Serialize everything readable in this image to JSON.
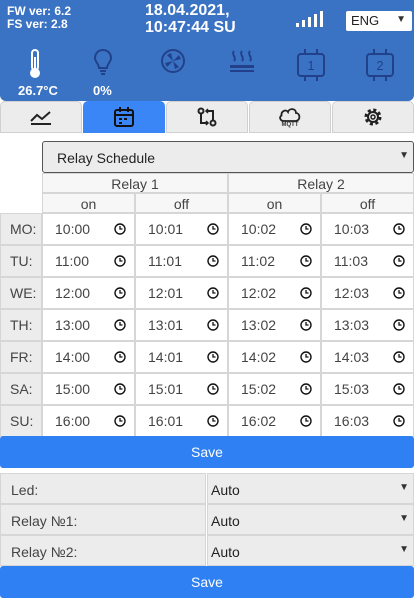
{
  "header": {
    "fw_version": "FW ver: 6.2",
    "fs_version": "FS ver: 2.8",
    "date": "18.04.2021,",
    "time": "10:47:44 SU",
    "language": "ENG",
    "temperature": "26.7°C",
    "light_level": "0%",
    "icons": [
      "thermometer-icon",
      "bulb-icon",
      "fan-icon",
      "heater-icon",
      "relay-1-icon",
      "relay-2-icon"
    ],
    "relay_1_label": "1",
    "relay_2_label": "2"
  },
  "tabs": [
    {
      "name": "chart",
      "active": false
    },
    {
      "name": "calendar",
      "active": true
    },
    {
      "name": "relays",
      "active": false
    },
    {
      "name": "mqtt",
      "label": "MQTT",
      "active": false
    },
    {
      "name": "settings",
      "active": false
    }
  ],
  "schedule": {
    "selected": "Relay Schedule",
    "relays": [
      "Relay 1",
      "Relay 2"
    ],
    "columns": [
      "on",
      "off",
      "on",
      "off"
    ],
    "rows": [
      {
        "day": "MO:",
        "times": [
          "10:00",
          "10:01",
          "10:02",
          "10:03"
        ]
      },
      {
        "day": "TU:",
        "times": [
          "11:00",
          "11:01",
          "11:02",
          "11:03"
        ]
      },
      {
        "day": "WE:",
        "times": [
          "12:00",
          "12:01",
          "12:02",
          "12:03"
        ]
      },
      {
        "day": "TH:",
        "times": [
          "13:00",
          "13:01",
          "13:02",
          "13:03"
        ]
      },
      {
        "day": "FR:",
        "times": [
          "14:00",
          "14:01",
          "14:02",
          "14:03"
        ]
      },
      {
        "day": "SA:",
        "times": [
          "15:00",
          "15:01",
          "15:02",
          "15:03"
        ]
      },
      {
        "day": "SU:",
        "times": [
          "16:00",
          "16:01",
          "16:02",
          "16:03"
        ]
      }
    ]
  },
  "save_label": "Save",
  "settings": [
    {
      "label": "Led:",
      "value": "Auto"
    },
    {
      "label": "Relay №1:",
      "value": "Auto"
    },
    {
      "label": "Relay №2:",
      "value": "Auto"
    }
  ],
  "colors": {
    "header": "#3b73c4",
    "accent": "#2f80f3",
    "active_tab": "#3b86f6"
  }
}
